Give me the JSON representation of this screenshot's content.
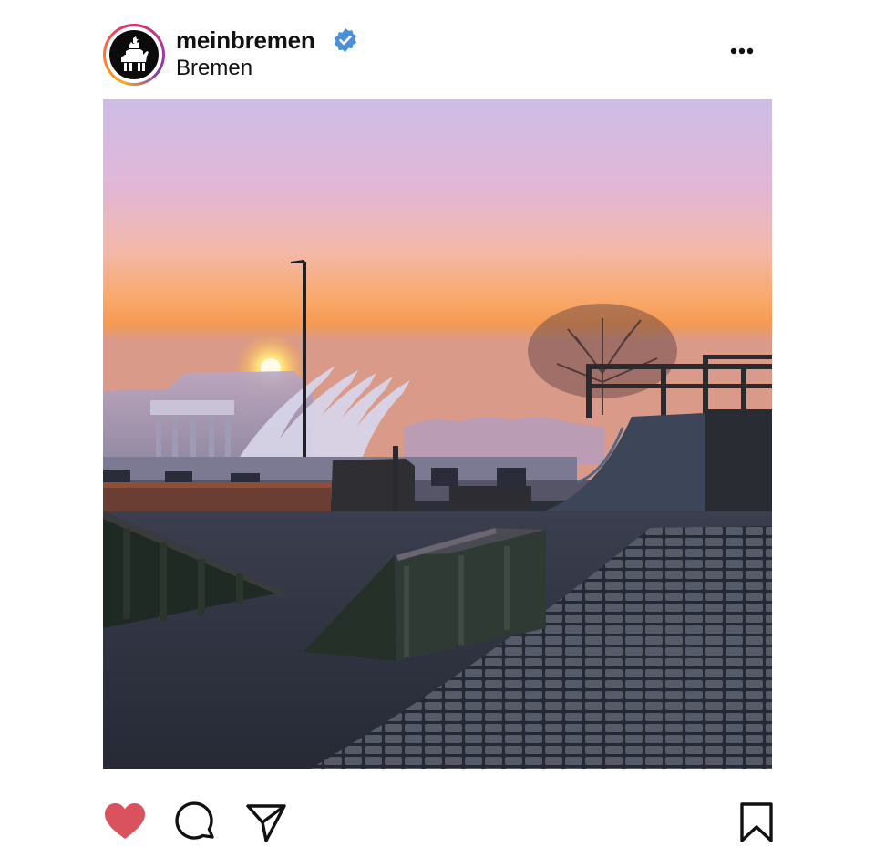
{
  "account": {
    "username": "meinbremen",
    "verified": true,
    "location": "Bremen",
    "avatar_icon": "bremen-town-musicians-logo"
  },
  "post": {
    "media_type": "photo",
    "liked": true
  },
  "icons": {
    "verified": "verified-badge-icon",
    "more": "more-options-icon",
    "like": "heart-icon",
    "comment": "comment-bubble-icon",
    "share": "paper-plane-icon",
    "save": "bookmark-icon"
  },
  "colors": {
    "text": "#111111",
    "verified": "#4a90d9",
    "like": "#d9525e",
    "ring_start": "#f9a825",
    "ring_end": "#c13584"
  }
}
